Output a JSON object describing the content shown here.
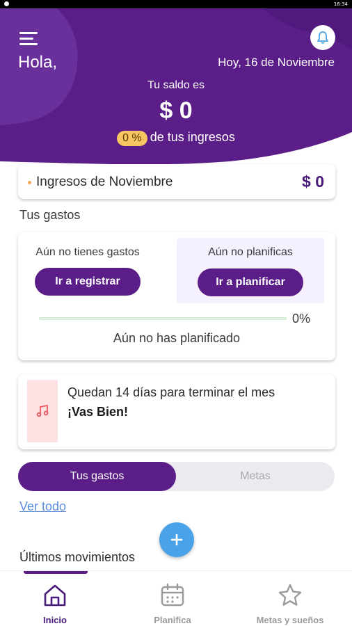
{
  "status_bar": {
    "time": "16:34"
  },
  "header": {
    "greeting": "Hola,",
    "date": "Hoy, 16 de Noviembre",
    "balance_label": "Tu saldo es",
    "balance_value": "$ 0",
    "income_percent": "0 %",
    "income_percent_suffix": "de tus ingresos",
    "colors": {
      "primary": "#5b1e88",
      "accent": "#f7c562"
    }
  },
  "income_card": {
    "label": "Ingresos de Noviembre",
    "amount": "$ 0"
  },
  "expenses": {
    "section_title": "Tus gastos",
    "no_expenses_text": "Aún no tienes gastos",
    "register_button": "Ir a registrar",
    "no_plan_text": "Aún no planificas",
    "plan_button": "Ir a planificar",
    "progress_percent": "0%",
    "progress_value": 0,
    "footer_text": "Aún no has planificado"
  },
  "month_card": {
    "icon": "music-note-icon",
    "days_text": "Quedan 14 días para terminar el mes",
    "status_text": "¡Vas Bien!"
  },
  "tabs": {
    "active": "Tus gastos",
    "inactive": "Metas"
  },
  "ver_todo": "Ver todo",
  "recent_title": "Últimos movimientos",
  "bottom_nav": {
    "items": [
      {
        "label": "Inicio",
        "icon": "home-icon",
        "active": true
      },
      {
        "label": "Planifica",
        "icon": "calendar-icon",
        "active": false
      },
      {
        "label": "Metas y sueños",
        "icon": "star-icon",
        "active": false
      }
    ]
  }
}
